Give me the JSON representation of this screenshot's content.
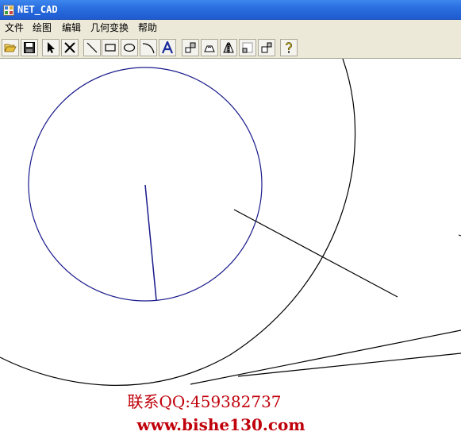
{
  "window": {
    "title": "NET_CAD"
  },
  "menu": {
    "items": [
      "文件",
      "绘图",
      "编辑",
      "几何变换",
      "帮助"
    ]
  },
  "toolbar": {
    "buttons": [
      "open-icon",
      "save-icon",
      "select-arrow-icon",
      "delete-x-icon",
      "line-tool-icon",
      "rectangle-tool-icon",
      "ellipse-tool-icon",
      "arc-tool-icon",
      "text-tool-icon",
      "translate-icon",
      "rotate-icon",
      "mirror-icon",
      "scale-down-icon",
      "scale-up-icon",
      "help-icon"
    ]
  },
  "colors": {
    "titlebar": "#2a6fe0",
    "chrome": "#ece9d8",
    "shape_blue": "#1a1a8c",
    "shape_black": "#000000",
    "watermark": "#c0000a"
  },
  "watermark": {
    "contact": "联系QQ:459382737",
    "site": "www.bishe130.com"
  }
}
